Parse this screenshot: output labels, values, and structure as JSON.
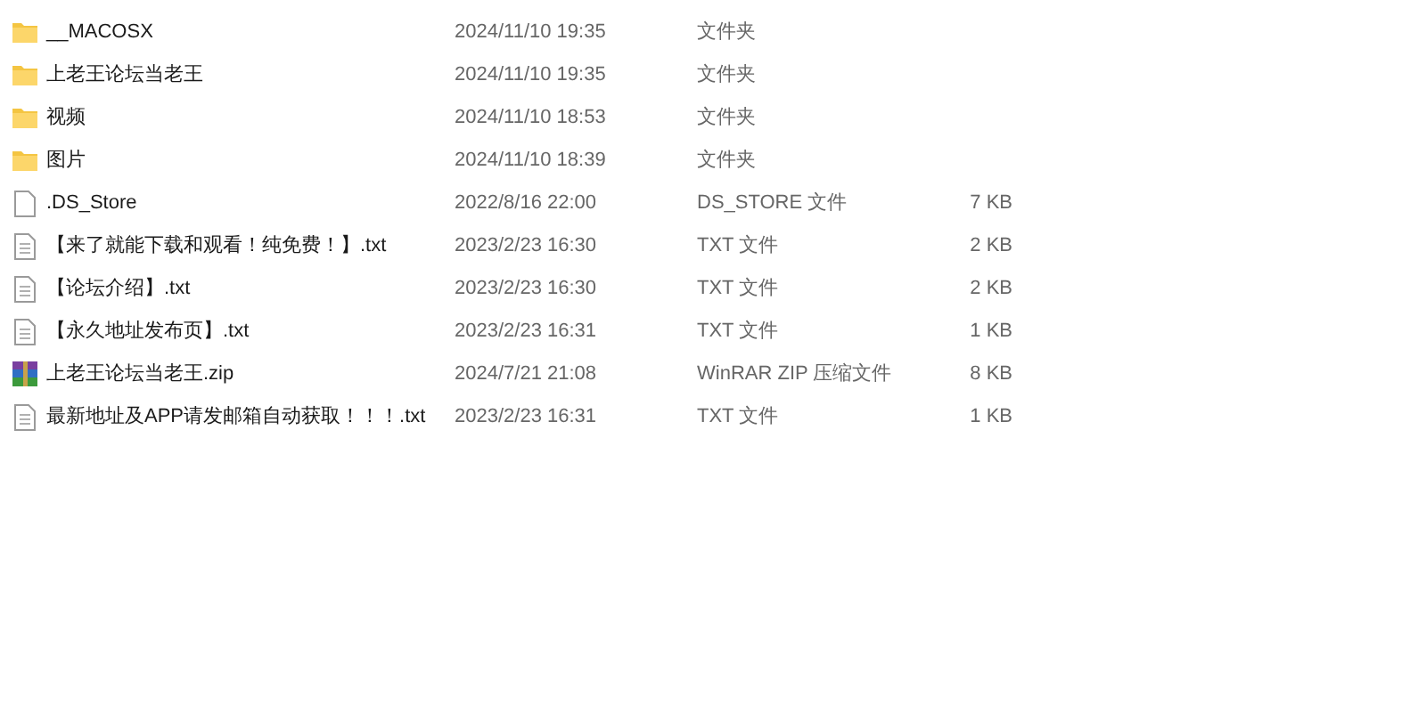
{
  "files": [
    {
      "kind": "folder",
      "name": "__MACOSX",
      "modified": "2024/11/10 19:35",
      "type": "文件夹"
    },
    {
      "kind": "folder",
      "name": "上老王论坛当老王",
      "modified": "2024/11/10 19:35",
      "type": "文件夹"
    },
    {
      "kind": "folder",
      "name": "视频",
      "modified": "2024/11/10 18:53",
      "type": "文件夹"
    },
    {
      "kind": "folder",
      "name": "图片",
      "modified": "2024/11/10 18:39",
      "type": "文件夹"
    },
    {
      "kind": "file",
      "name": ".DS_Store",
      "modified": "2022/8/16 22:00",
      "type": "DS_STORE 文件",
      "size": "7 KB"
    },
    {
      "kind": "text",
      "name": "【来了就能下载和观看！纯免费！】.txt",
      "modified": "2023/2/23 16:30",
      "type": "TXT 文件",
      "size": "2 KB"
    },
    {
      "kind": "text",
      "name": "【论坛介绍】.txt",
      "modified": "2023/2/23 16:30",
      "type": "TXT 文件",
      "size": "2 KB"
    },
    {
      "kind": "text",
      "name": "【永久地址发布页】.txt",
      "modified": "2023/2/23 16:31",
      "type": "TXT 文件",
      "size": "1 KB"
    },
    {
      "kind": "archive",
      "name": "上老王论坛当老王.zip",
      "modified": "2024/7/21 21:08",
      "type": "WinRAR ZIP 压缩文件",
      "size": "8 KB"
    },
    {
      "kind": "text",
      "name": "最新地址及APP请发邮箱自动获取！！！.txt",
      "modified": "2023/2/23 16:31",
      "type": "TXT 文件",
      "size": "1 KB"
    }
  ]
}
